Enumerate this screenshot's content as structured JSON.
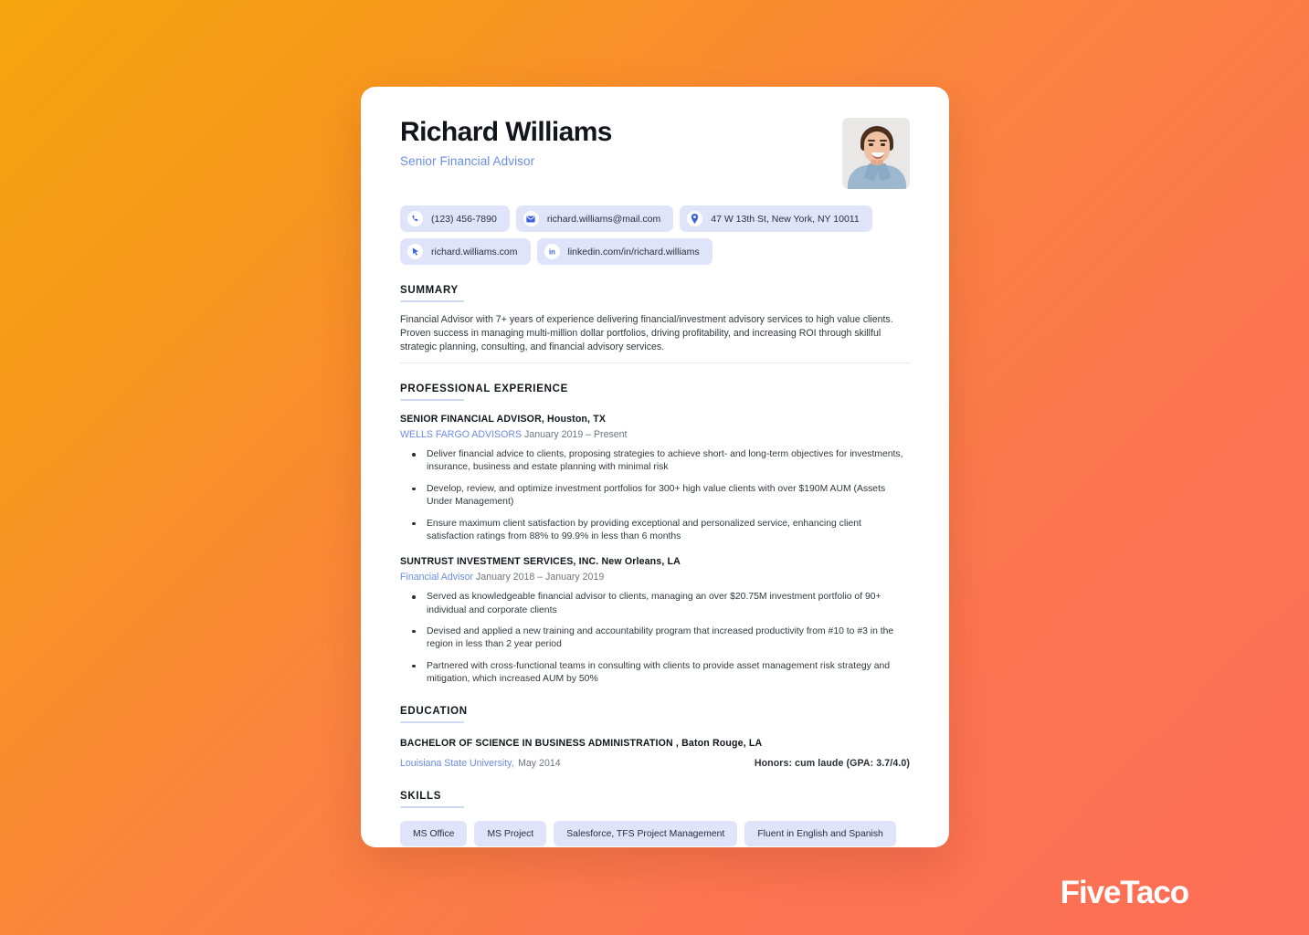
{
  "background": {
    "gradient_from": "#F5A50C",
    "gradient_to": "#FD6E57"
  },
  "watermark": {
    "label": "FiveTaco"
  },
  "resume": {
    "name": "Richard Williams",
    "job_title": "Senior Financial Advisor",
    "photo_alt": "headshot-photo",
    "contacts": [
      [
        {
          "icon": "phone-icon",
          "value": "(123) 456-7890"
        },
        {
          "icon": "email-icon",
          "value": "richard.williams@mail.com"
        },
        {
          "icon": "location-pin-icon",
          "value": "47 W 13th St, New York, NY 10011"
        }
      ],
      [
        {
          "icon": "cursor-icon",
          "value": "richard.williams.com"
        },
        {
          "icon": "linkedin-icon",
          "value": "linkedin.com/in/richard.williams"
        }
      ]
    ],
    "sections": {
      "summary": {
        "title": "SUMMARY",
        "text": "Financial Advisor with 7+ years of experience delivering financial/investment advisory services to high value clients. Proven success in managing multi-million dollar portfolios, driving profitability, and increasing ROI through skillful strategic planning, consulting, and financial advisory services."
      },
      "experience": {
        "title": "PROFESSIONAL EXPERIENCE",
        "jobs": [
          {
            "heading": "SENIOR FINANCIAL ADVISOR,  Houston, TX",
            "company": "WELLS FARGO ADVISORS",
            "dates": "January 2019 – Present",
            "bullets": [
              "Deliver financial advice to clients, proposing strategies to achieve short- and long-term objectives for investments, insurance, business and estate planning with minimal risk",
              "Develop, review, and optimize investment portfolios for 300+ high value clients with over $190M AUM (Assets Under Management)",
              "Ensure maximum client satisfaction by providing exceptional and personalized service, enhancing client satisfaction ratings from 88% to 99.9% in less than 6 months"
            ]
          },
          {
            "heading": "SUNTRUST INVESTMENT  SERVICES, INC.  New Orleans, LA",
            "company": "Financial Advisor",
            "dates": "January 2018 – January 2019",
            "bullets": [
              "Served as knowledgeable financial advisor to clients, managing an over $20.75M investment portfolio of 90+ individual and corporate clients",
              "Devised and applied a new training and accountability program that increased productivity from #10 to #3 in the region in less than 2 year period",
              "Partnered with cross-functional teams in consulting with clients to provide asset management risk strategy and mitigation, which increased AUM by 50%"
            ]
          }
        ]
      },
      "education": {
        "title": "EDUCATION",
        "degree": "BACHELOR OF SCIENCE IN BUSINESS ADMINISTRATION ,  Baton Rouge, LA",
        "school": "Louisiana State University,",
        "date": "May 2014",
        "honors": "Honors: cum laude (GPA: 3.7/4.0)"
      },
      "skills": {
        "title": "SKILLS",
        "items": [
          "MS Office",
          "MS Project",
          "Salesforce, TFS Project Management",
          "Fluent in English and Spanish"
        ]
      }
    }
  }
}
